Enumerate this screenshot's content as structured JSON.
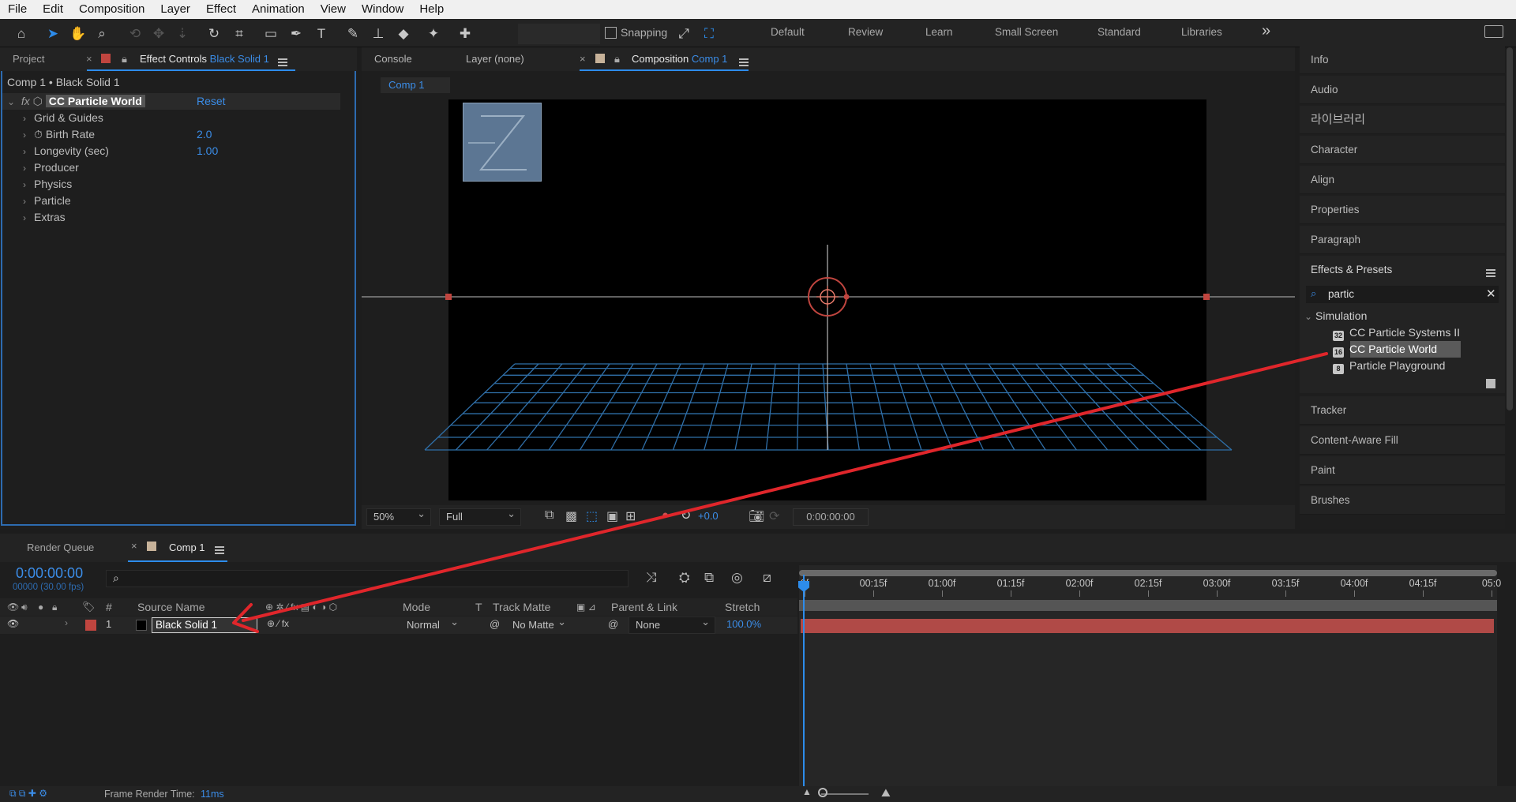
{
  "menu": [
    "File",
    "Edit",
    "Composition",
    "Layer",
    "Effect",
    "Animation",
    "View",
    "Window",
    "Help"
  ],
  "toolbar": {
    "snapping_label": "Snapping",
    "workspaces": [
      "Default",
      "Review",
      "Learn",
      "Small Screen",
      "Standard",
      "Libraries"
    ],
    "more_label": "»"
  },
  "left_panel": {
    "tab_project": "Project",
    "tab_effect_controls": "Effect Controls",
    "tab_effect_controls_layer": "Black Solid 1",
    "breadcrumb": "Comp 1 • Black Solid 1",
    "effect_name": "CC Particle World",
    "reset_label": "Reset",
    "properties": [
      {
        "label": "Grid & Guides",
        "value": ""
      },
      {
        "label": "Birth Rate",
        "value": "2.0"
      },
      {
        "label": "Longevity (sec)",
        "value": "1.00"
      },
      {
        "label": "Producer",
        "value": ""
      },
      {
        "label": "Physics",
        "value": ""
      },
      {
        "label": "Particle",
        "value": ""
      },
      {
        "label": "Extras",
        "value": ""
      }
    ]
  },
  "center_panel": {
    "tab_console": "Console",
    "tab_layer": "Layer (none)",
    "tab_composition": "Composition",
    "tab_composition_name": "Comp 1",
    "comp_chip": "Comp 1",
    "zoom": "50%",
    "resolution": "Full",
    "exposure": "+0.0",
    "timecode": "0:00:00:00"
  },
  "right_panel": {
    "items_top": [
      "Info",
      "Audio",
      "라이브러리",
      "Character",
      "Align",
      "Properties",
      "Paragraph"
    ],
    "effects_presets_title": "Effects & Presets",
    "search_value": "partic",
    "category": "Simulation",
    "results": [
      "CC Particle Systems II",
      "CC Particle World",
      "Particle Playground"
    ],
    "items_bottom": [
      "Tracker",
      "Content-Aware Fill",
      "Paint",
      "Brushes"
    ]
  },
  "timeline": {
    "tab_render_queue": "Render Queue",
    "tab_comp": "Comp 1",
    "timecode": "0:00:00:00",
    "frames": "00000 (30.00 fps)",
    "columns": {
      "num": "#",
      "source_name": "Source Name",
      "mode": "Mode",
      "t": "T",
      "track_matte": "Track Matte",
      "parent_link": "Parent & Link",
      "stretch": "Stretch"
    },
    "layer": {
      "num": "1",
      "name": "Black Solid 1",
      "mode": "Normal",
      "track_matte": "No Matte",
      "parent": "None",
      "stretch": "100.0%"
    },
    "ruler": [
      "0f",
      "00:15f",
      "01:00f",
      "01:15f",
      "02:00f",
      "02:15f",
      "03:00f",
      "03:15f",
      "04:00f",
      "04:15f",
      "05:0"
    ],
    "footer_label": "Frame Render Time:",
    "footer_value": "11ms"
  },
  "colors": {
    "accent": "#2d8ceb",
    "layer_label": "#c0453f",
    "layer_bar": "#b04a47",
    "grid": "#2f6fa8",
    "arrow": "#e0262b"
  }
}
